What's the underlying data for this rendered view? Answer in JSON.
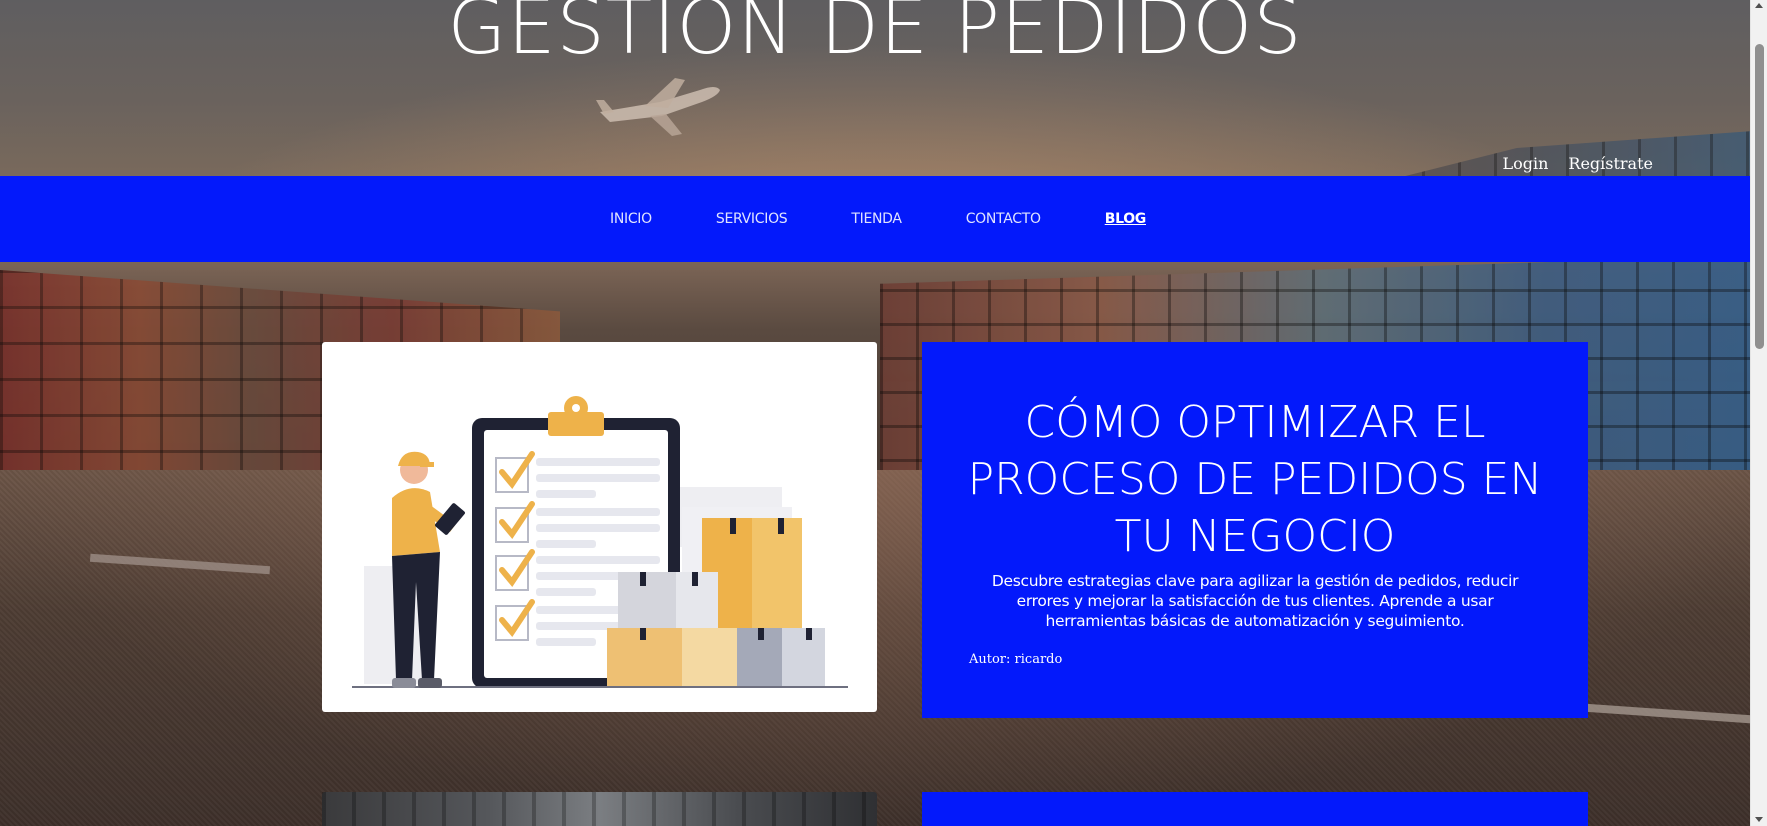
{
  "header": {
    "site_title": "GESTIÓN DE PEDIDOS",
    "login_label": "Login",
    "register_label": "Regístrate"
  },
  "nav": {
    "items": [
      {
        "label": "INICIO",
        "active": false
      },
      {
        "label": "SERVICIOS",
        "active": false
      },
      {
        "label": "TIENDA",
        "active": false
      },
      {
        "label": "CONTACTO",
        "active": false
      },
      {
        "label": "BLOG",
        "active": true
      }
    ]
  },
  "posts": [
    {
      "title": "CÓMO OPTIMIZAR EL PROCESO DE PEDIDOS EN TU NEGOCIO",
      "excerpt": "Descubre estrategias clave para agilizar la gestión de pedidos, reducir errores y mejorar la satisfacción de tus clientes. Aprende a usar herramientas básicas de automatización y seguimiento.",
      "author": "Autor: ricardo",
      "image_icon": "order-checklist-illustration"
    }
  ],
  "colors": {
    "nav_background": "#0319fb",
    "card_background": "#0319fb",
    "text": "#ffffff"
  }
}
